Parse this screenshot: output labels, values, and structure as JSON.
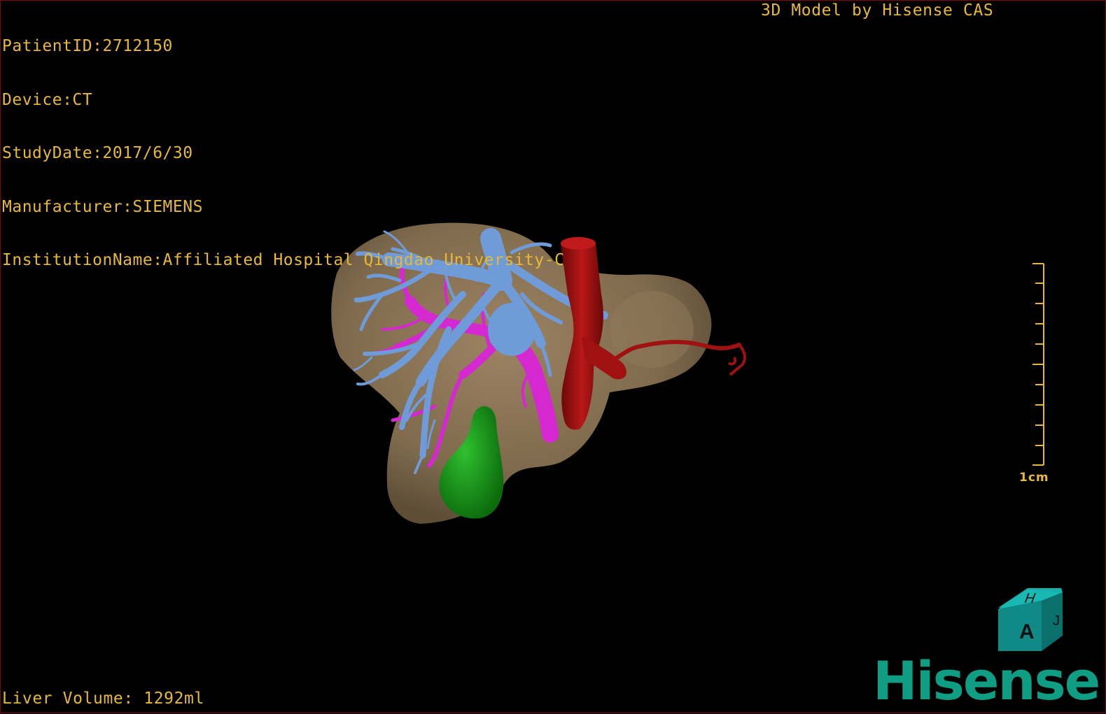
{
  "info": {
    "patient_id": "PatientID:2712150",
    "device": "Device:CT",
    "study_date": "StudyDate:2017/6/30",
    "manufacturer": "Manufacturer:SIEMENS",
    "institution": "InstitutionName:Affiliated Hospital Qingdao University-C"
  },
  "header": {
    "title": "3D Model by Hisense CAS"
  },
  "footer": {
    "liver_volume": "Liver Volume: 1292ml"
  },
  "scale_bar": {
    "label": "1cm"
  },
  "orientation_cube": {
    "front": "A",
    "top": "H",
    "side": "J"
  },
  "logo": {
    "text": "Hisense"
  },
  "colors": {
    "overlay_text": "#e8b838",
    "liver": "#8a7456",
    "hepatic_vein": "#6f9bd8",
    "portal_vein": "#d628d0",
    "vena_cava": "#a01212",
    "gallbladder": "#1fa21f",
    "logo": "#0f9e84",
    "cube": "#0f8a86"
  }
}
